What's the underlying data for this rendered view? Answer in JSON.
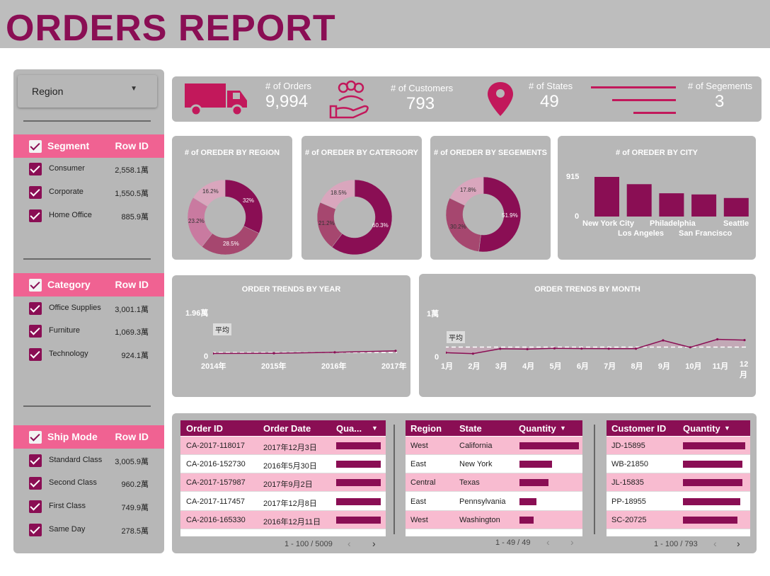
{
  "title": "ORDERS REPORT",
  "sidebar": {
    "region_dropdown": "Region",
    "segment": {
      "header": "Segment",
      "metric": "Row ID",
      "items": [
        {
          "name": "Consumer",
          "value": "2,558.1萬"
        },
        {
          "name": "Corporate",
          "value": "1,550.5萬"
        },
        {
          "name": "Home Office",
          "value": "885.9萬"
        }
      ]
    },
    "category": {
      "header": "Category",
      "metric": "Row ID",
      "items": [
        {
          "name": "Office Supplies",
          "value": "3,001.1萬"
        },
        {
          "name": "Furniture",
          "value": "1,069.3萬"
        },
        {
          "name": "Technology",
          "value": "924.1萬"
        }
      ]
    },
    "shipmode": {
      "header": "Ship Mode",
      "metric": "Row ID",
      "items": [
        {
          "name": "Standard Class",
          "value": "3,005.9萬"
        },
        {
          "name": "Second Class",
          "value": "960.2萬"
        },
        {
          "name": "First Class",
          "value": "749.9萬"
        },
        {
          "name": "Same Day",
          "value": "278.5萬"
        }
      ]
    }
  },
  "kpis": {
    "orders": {
      "label": "# of Orders",
      "value": "9,994"
    },
    "customers": {
      "label": "# of Customers",
      "value": "793"
    },
    "states": {
      "label": "# of States",
      "value": "49"
    },
    "segments": {
      "label": "# of Segements",
      "value": "3"
    }
  },
  "colors": {
    "accent": "#8a0e54",
    "pink": "#f06292",
    "light_pink": "#f8bbd0",
    "panel": "#b7b7b7"
  },
  "chart_data": [
    {
      "type": "pie",
      "title": "# of OREDER BY REGION",
      "labels": [
        "32%",
        "28.5%",
        "23.2%",
        "16.2%"
      ],
      "values": [
        32,
        28.5,
        23.2,
        16.2
      ],
      "colors": [
        "#8a0e54",
        "#a6476f",
        "#c97aa0",
        "#d9a6bd"
      ]
    },
    {
      "type": "pie",
      "title": "# of OREDER BY CATERGORY",
      "labels": [
        "60.3%",
        "21.2%",
        "18.5%"
      ],
      "values": [
        60.3,
        21.2,
        18.5
      ],
      "colors": [
        "#8a0e54",
        "#a6476f",
        "#d9a6bd"
      ]
    },
    {
      "type": "pie",
      "title": "# of OREDER BY SEGEMENTS",
      "labels": [
        "51.9%",
        "30.2%",
        "17.8%"
      ],
      "values": [
        51.9,
        30.2,
        17.8
      ],
      "colors": [
        "#8a0e54",
        "#a6476f",
        "#d9a6bd"
      ]
    },
    {
      "type": "bar",
      "title": "# of OREDER BY CITY",
      "categories": [
        "New York City",
        "Los Angeles",
        "Philadelphia",
        "San Francisco",
        "Seattle"
      ],
      "values": [
        915,
        747,
        537,
        510,
        428
      ],
      "yticks": [
        "915",
        "0"
      ],
      "ylim": [
        0,
        915
      ]
    },
    {
      "type": "line",
      "title": "ORDER TRENDS BY YEAR",
      "x": [
        "2014年",
        "2015年",
        "2016年",
        "2017年"
      ],
      "values": [
        1993,
        2102,
        2587,
        3312
      ],
      "ylim": [
        0,
        19600
      ],
      "yticks": [
        "1.96萬",
        "0"
      ],
      "avg_label": "平均",
      "avg": 2498
    },
    {
      "type": "line",
      "title": "ORDER TRENDS BY MONTH",
      "x": [
        "1月",
        "2月",
        "3月",
        "4月",
        "5月",
        "6月",
        "7月",
        "8月",
        "9月",
        "10月",
        "11月",
        "12月"
      ],
      "values": [
        381,
        300,
        696,
        668,
        735,
        717,
        710,
        706,
        1383,
        819,
        1471,
        1408
      ],
      "ylim": [
        0,
        3000
      ],
      "yticks": [
        "1萬",
        "0"
      ],
      "avg_label": "平均",
      "avg": 833
    }
  ],
  "tables": {
    "orders": {
      "headers": [
        "Order ID",
        "Order Date",
        "Qua..."
      ],
      "rows": [
        {
          "id": "CA-2017-118017",
          "date": "2017年12月3日",
          "q": 0.95
        },
        {
          "id": "CA-2016-152730",
          "date": "2016年5月30日",
          "q": 0.95
        },
        {
          "id": "CA-2017-157987",
          "date": "2017年9月2日",
          "q": 0.95
        },
        {
          "id": "CA-2017-117457",
          "date": "2017年12月8日",
          "q": 0.95
        },
        {
          "id": "CA-2016-165330",
          "date": "2016年12月11日",
          "q": 0.95
        }
      ],
      "pager": "1 - 100 / 5009"
    },
    "regions": {
      "headers": [
        "Region",
        "State",
        "Quantity"
      ],
      "rows": [
        {
          "region": "West",
          "state": "California",
          "q": 1.0
        },
        {
          "region": "East",
          "state": "New York",
          "q": 0.55
        },
        {
          "region": "Central",
          "state": "Texas",
          "q": 0.49
        },
        {
          "region": "East",
          "state": "Pennsylvania",
          "q": 0.28
        },
        {
          "region": "West",
          "state": "Washington",
          "q": 0.24
        }
      ],
      "pager": "1 - 49 / 49"
    },
    "customers": {
      "headers": [
        "Customer ID",
        "Quantity"
      ],
      "rows": [
        {
          "id": "JD-15895",
          "q": 1.0
        },
        {
          "id": "WB-21850",
          "q": 0.96
        },
        {
          "id": "JL-15835",
          "q": 0.95
        },
        {
          "id": "PP-18955",
          "q": 0.92
        },
        {
          "id": "SC-20725",
          "q": 0.88
        }
      ],
      "pager": "1 - 100 / 793"
    }
  }
}
